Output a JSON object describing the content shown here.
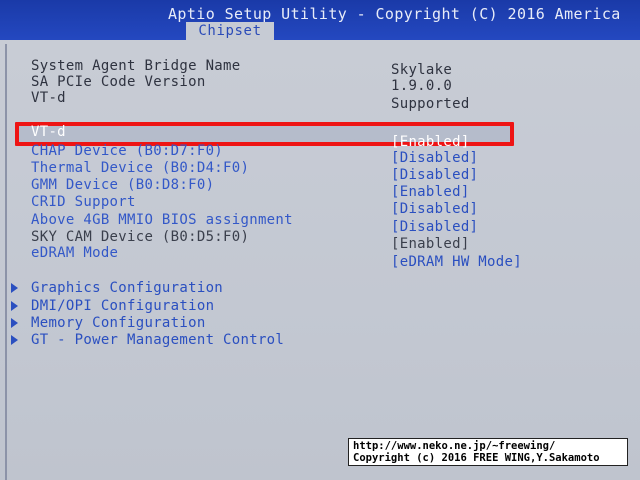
{
  "header": {
    "title": "Aptio Setup Utility - Copyright (C) 2016 America",
    "active_tab": "Chipset"
  },
  "info": [
    {
      "label": "System Agent Bridge Name",
      "value": "Skylake"
    },
    {
      "label": "SA PCIe Code Version",
      "value": "1.9.0.0"
    },
    {
      "label": "VT-d",
      "value": "Supported"
    }
  ],
  "settings": [
    {
      "label": "VT-d",
      "value": "[Enabled]"
    },
    {
      "label": "CHAP Device (B0:D7:F0)",
      "value": "[Disabled]"
    },
    {
      "label": "Thermal Device (B0:D4:F0)",
      "value": "[Disabled]"
    },
    {
      "label": "GMM Device (B0:D8:F0)",
      "value": "[Enabled]"
    },
    {
      "label": "CRID Support",
      "value": "[Disabled]"
    },
    {
      "label": "Above 4GB MMIO BIOS assignment",
      "value": "[Disabled]"
    },
    {
      "label": "SKY CAM Device (B0:D5:F0)",
      "value": "[Enabled]"
    },
    {
      "label": "eDRAM Mode",
      "value": "[eDRAM HW Mode]"
    }
  ],
  "submenus": [
    {
      "label": "Graphics Configuration"
    },
    {
      "label": "DMI/OPI Configuration"
    },
    {
      "label": "Memory Configuration"
    },
    {
      "label": "GT - Power Management Control"
    }
  ],
  "watermark": {
    "line1": "http://www.neko.ne.jp/~freewing/",
    "line2": "Copyright (c) 2016 FREE WING,Y.Sakamoto"
  },
  "colors": {
    "title_bar": "#2448c0",
    "panel_bg": "#c6cbd4",
    "highlight_box": "#ee1414",
    "setting_text": "#2a4fc0"
  }
}
